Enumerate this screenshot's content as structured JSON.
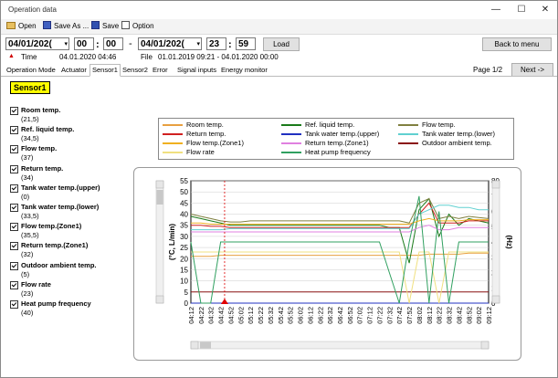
{
  "window": {
    "title": "Operation data",
    "controls": {
      "minimize": "—",
      "maximize": "☐",
      "close": "✕"
    }
  },
  "menu": {
    "open": "Open",
    "save_as": "Save As ...",
    "save": "Save",
    "option": "Option"
  },
  "range": {
    "start_date": "04/01/202(",
    "start_hour": "00",
    "start_min": "00",
    "sep_colon": ":",
    "dash": "-",
    "end_date": "04/01/202(",
    "end_hour": "23",
    "end_min": "59",
    "load_label": "Load",
    "back_label": "Back to menu"
  },
  "info": {
    "time_label": "Time",
    "time_value": "04.01.2020 04:46",
    "file_label": "File",
    "file_value": "01.01.2019 09:21 - 04.01.2020 00:00",
    "page": "Page 1/2",
    "next_label": "Next ->"
  },
  "tabs": [
    "Operation Mode",
    "Actuator",
    "Sensor1",
    "Sensor2",
    "Error",
    "Signal inputs",
    "Energy monitor"
  ],
  "active_tab": "Sensor1",
  "sensor_title": "Sensor1",
  "sensors": [
    {
      "label": "Room temp.",
      "value": "(21,5)"
    },
    {
      "label": "Ref. liquid temp.",
      "value": "(34,5)"
    },
    {
      "label": "Flow temp.",
      "value": "(37)"
    },
    {
      "label": "Return temp.",
      "value": "(34)"
    },
    {
      "label": "Tank water temp.(upper)",
      "value": "(0)"
    },
    {
      "label": "Tank water temp.(lower)",
      "value": "(33,5)"
    },
    {
      "label": "Flow temp.(Zone1)",
      "value": "(35,5)"
    },
    {
      "label": "Return temp.(Zone1)",
      "value": "(32)"
    },
    {
      "label": "Outdoor ambient temp.",
      "value": "(5)"
    },
    {
      "label": "Flow rate",
      "value": "(23)"
    },
    {
      "label": "Heat pump frequency",
      "value": "(40)"
    }
  ],
  "legend": [
    {
      "label": "Room temp.",
      "color": "#e8a040"
    },
    {
      "label": "Ref. liquid temp.",
      "color": "#1a7a1a"
    },
    {
      "label": "Flow temp.",
      "color": "#808040"
    },
    {
      "label": "Return temp.",
      "color": "#d02020"
    },
    {
      "label": "Tank water temp.(upper)",
      "color": "#2030c0"
    },
    {
      "label": "Tank water temp.(lower)",
      "color": "#60d0d0"
    },
    {
      "label": "Flow temp.(Zone1)",
      "color": "#f0b020"
    },
    {
      "label": "Return temp.(Zone1)",
      "color": "#e080e0"
    },
    {
      "label": "Outdoor ambient temp.",
      "color": "#8a1010"
    },
    {
      "label": "Flow rate",
      "color": "#f0e080"
    },
    {
      "label": "Heat pump frequency",
      "color": "#30a060"
    }
  ],
  "chart_data": {
    "type": "line",
    "ylabel": "(°C, L/min)",
    "y2label": "(Hz)",
    "ylim": [
      0,
      55
    ],
    "y2lim": [
      0,
      80
    ],
    "yticks": [
      0,
      5,
      10,
      15,
      20,
      25,
      30,
      35,
      40,
      45,
      50,
      55
    ],
    "y2ticks": [
      0,
      10,
      20,
      30,
      40,
      50,
      60,
      70,
      80
    ],
    "x": [
      "04:12",
      "04:22",
      "04:32",
      "04:42",
      "04:52",
      "05:02",
      "05:12",
      "05:22",
      "05:32",
      "05:42",
      "05:52",
      "06:02",
      "06:12",
      "06:22",
      "06:32",
      "06:42",
      "06:52",
      "07:02",
      "07:12",
      "07:22",
      "07:32",
      "07:42",
      "07:52",
      "08:02",
      "08:12",
      "08:22",
      "08:32",
      "08:42",
      "08:52",
      "09:02",
      "09:12"
    ],
    "cursor_time": "04:46",
    "series": [
      {
        "name": "Room temp.",
        "color": "#e8a040",
        "values": [
          21,
          21,
          21,
          21.5,
          21.5,
          21.5,
          21.5,
          21.5,
          21.5,
          21.5,
          21.5,
          21.5,
          21.5,
          21.5,
          21.5,
          21.5,
          21.5,
          21.5,
          21.5,
          21.5,
          21.5,
          21.5,
          21.5,
          21.5,
          22,
          22,
          22,
          22,
          22.5,
          22.5,
          22.5
        ]
      },
      {
        "name": "Ref. liquid temp.",
        "color": "#1a7a1a",
        "values": [
          39,
          38,
          37,
          36,
          35,
          35,
          35,
          35,
          35,
          35,
          35,
          35,
          35,
          35,
          35,
          35,
          35,
          35,
          35,
          35,
          34,
          34,
          18,
          42,
          47,
          30,
          40,
          35,
          38,
          37,
          36
        ]
      },
      {
        "name": "Flow temp.",
        "color": "#808040",
        "values": [
          40,
          39,
          38,
          37,
          36.5,
          36.5,
          37,
          37,
          37,
          37,
          37,
          37,
          37,
          37,
          37,
          37,
          37,
          37,
          37,
          37,
          37,
          37,
          36,
          45,
          47,
          38,
          39,
          38,
          39,
          38.5,
          38
        ]
      },
      {
        "name": "Return temp.",
        "color": "#d02020",
        "values": [
          35,
          35,
          34.5,
          34.5,
          34,
          34,
          34,
          34,
          34,
          34,
          34,
          34,
          34,
          34,
          34,
          34,
          34,
          34,
          34,
          34,
          34,
          34,
          34,
          40,
          45,
          36,
          36,
          36,
          37,
          37,
          37
        ]
      },
      {
        "name": "Tank water temp.(upper)",
        "color": "#2030c0",
        "values": [
          0,
          0,
          0,
          0,
          0,
          0,
          0,
          0,
          0,
          0,
          0,
          0,
          0,
          0,
          0,
          0,
          0,
          0,
          0,
          0,
          0,
          0,
          0,
          0,
          0,
          0,
          0,
          0,
          0,
          0,
          0
        ]
      },
      {
        "name": "Tank water temp.(lower)",
        "color": "#60d0d0",
        "values": [
          33,
          33,
          33,
          33,
          33.5,
          33.5,
          33.5,
          33.5,
          33.5,
          33.5,
          33.5,
          33.5,
          33.5,
          33.5,
          33.5,
          33.5,
          33.5,
          33.5,
          33.5,
          33.5,
          33.5,
          33.5,
          33.5,
          40,
          42,
          44,
          44,
          43,
          43,
          42,
          42
        ]
      },
      {
        "name": "Flow temp.(Zone1)",
        "color": "#f0b020",
        "values": [
          36,
          36,
          35.5,
          35.5,
          35.5,
          35.5,
          35.5,
          35.5,
          35.5,
          35.5,
          35.5,
          35.5,
          35.5,
          35.5,
          35.5,
          35.5,
          35.5,
          35.5,
          35.5,
          35.5,
          35.5,
          35.5,
          35.5,
          37,
          38,
          37,
          37,
          37,
          37.5,
          37.5,
          37.5
        ]
      },
      {
        "name": "Return temp.(Zone1)",
        "color": "#e080e0",
        "values": [
          32,
          32,
          32,
          32,
          32,
          32,
          32,
          32,
          32,
          32,
          32,
          32,
          32,
          32,
          32,
          32,
          32,
          32,
          32,
          32,
          32,
          32,
          32,
          34,
          35,
          33,
          33,
          34,
          34,
          34,
          34
        ]
      },
      {
        "name": "Outdoor ambient temp.",
        "color": "#8a1010",
        "values": [
          5,
          5,
          5,
          5,
          5,
          5,
          5,
          5,
          5,
          5,
          5,
          5,
          5,
          5,
          5,
          5,
          5,
          5,
          5,
          5,
          5,
          5,
          5,
          5,
          5,
          5,
          5,
          5,
          5,
          5,
          5
        ]
      },
      {
        "name": "Flow rate",
        "color": "#f0e080",
        "values": [
          23,
          23,
          23,
          23,
          23,
          23,
          23,
          23,
          23,
          23,
          23,
          23,
          23,
          23,
          23,
          23,
          23,
          23,
          23,
          23,
          23,
          23,
          0,
          23,
          23,
          0,
          23,
          23,
          23,
          23,
          23
        ]
      },
      {
        "name": "Heat pump frequency",
        "color": "#30a060",
        "values": [
          40,
          0,
          0,
          40,
          40,
          40,
          40,
          40,
          40,
          40,
          40,
          40,
          40,
          40,
          40,
          40,
          40,
          40,
          40,
          40,
          20,
          0,
          40,
          70,
          0,
          60,
          0,
          40,
          40,
          40,
          40
        ]
      }
    ]
  }
}
